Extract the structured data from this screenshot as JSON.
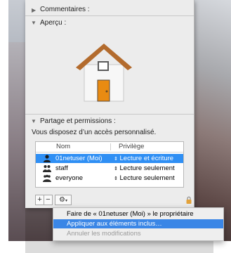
{
  "sections": {
    "comments": "Commentaires :",
    "preview": "Aperçu :",
    "sharing": "Partage et permissions :",
    "access_note": "Vous disposez d’un accès personnalisé."
  },
  "table": {
    "headers": {
      "name": "Nom",
      "privilege": "Privilège"
    },
    "rows": [
      {
        "name": "01netuser (Moi)",
        "privilege": "Lecture et écriture",
        "icon": "user-icon",
        "selected": true
      },
      {
        "name": "staff",
        "privilege": "Lecture seulement",
        "icon": "group-icon",
        "selected": false
      },
      {
        "name": "everyone",
        "privilege": "Lecture seulement",
        "icon": "group-icon",
        "selected": false
      }
    ]
  },
  "toolbar": {
    "add": "+",
    "remove": "−",
    "action": "gear-icon"
  },
  "menu": {
    "items": [
      {
        "label": "Faire de « 01netuser (Moi) » le propriétaire",
        "state": "normal"
      },
      {
        "label": "Appliquer aux éléments inclus…",
        "state": "highlighted"
      },
      {
        "label": "Annuler les modifications",
        "state": "disabled"
      }
    ]
  },
  "colors": {
    "selection": "#2f8ff4",
    "menu_highlight": "#3a86e6",
    "house_roof": "#b36b2d",
    "house_door": "#e98b12"
  }
}
